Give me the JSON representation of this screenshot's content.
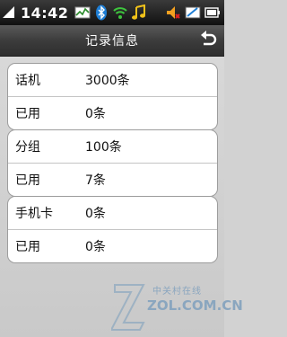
{
  "status_bar": {
    "time": "14:42",
    "icons": [
      "signal-icon",
      "activity-icon",
      "bluetooth-icon",
      "wifi-icon",
      "music-icon",
      "volume-icon",
      "message-icon",
      "battery-icon"
    ]
  },
  "header": {
    "title": "记录信息",
    "back_icon": "back-arrow-icon"
  },
  "groups": [
    {
      "rows": [
        {
          "label": "话机",
          "value": "3000条"
        },
        {
          "label": "已用",
          "value": "0条"
        }
      ]
    },
    {
      "rows": [
        {
          "label": "分组",
          "value": "100条"
        },
        {
          "label": "已用",
          "value": "7条"
        }
      ]
    },
    {
      "rows": [
        {
          "label": "手机卡",
          "value": "0条"
        },
        {
          "label": "已用",
          "value": "0条"
        }
      ]
    }
  ],
  "watermark": {
    "line1": "中关村在线",
    "line2": "ZOL.COM.CN"
  },
  "colors": {
    "accent_blue": "#1f7fd6",
    "wifi_green": "#3ec63e",
    "music_yellow": "#f2c21a",
    "background": "#d2d2d2"
  }
}
